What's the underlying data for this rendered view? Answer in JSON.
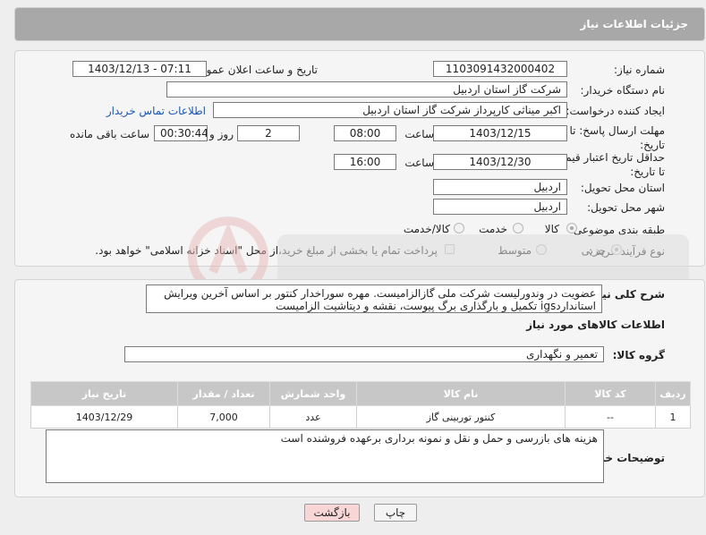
{
  "header": {
    "title": "جزئیات اطلاعات نیاز"
  },
  "fields": {
    "need_number_label": "شماره نیاز:",
    "need_number": "1103091432000402",
    "announce_label": "تاریخ و ساعت اعلان عمومی:",
    "announce_value": "1403/12/13 - 07:11",
    "buyer_org_label": "نام دستگاه خریدار:",
    "buyer_org": "شرکت گاز استان اردبیل",
    "creator_label": "ایجاد کننده درخواست:",
    "creator": "اکبر میناثی کارپرداز شرکت گاز استان اردبیل",
    "contact_link": "اطلاعات تماس خریدار",
    "deadline_label": "مهلت ارسال پاسخ: تا تاریخ:",
    "deadline_date": "1403/12/15",
    "time_label": "ساعت",
    "deadline_time": "08:00",
    "days_value": "2",
    "days_label": "روز و",
    "remaining_time": "00:30:44",
    "remaining_label": "ساعت باقی مانده",
    "min_validity_label": "حداقل تاریخ اعتبار قیمت: تا تاریخ:",
    "validity_date": "1403/12/30",
    "validity_time": "16:00",
    "province_label": "استان محل تحویل:",
    "province": "اردبیل",
    "city_label": "شهر محل تحویل:",
    "city": "اردبیل",
    "category_label": "طبقه بندی موضوعی:",
    "cat_goods": "کالا",
    "cat_service": "خدمت",
    "cat_goods_service": "کالا/خدمت",
    "process_label": "نوع فرآیند خرید :",
    "proc_minor": "جزیی",
    "proc_medium": "متوسط",
    "payment_note": "پرداخت تمام یا بخشی از مبلغ خرید،از محل \"اسناد خزانه اسلامی\" خواهد بود."
  },
  "description": {
    "label": "شرح کلی نیاز:",
    "text": "عضویت در وندورلیست شرکت ملی گازالزامیست. مهره سوراخدار کنتور بر اساس آخرین ویرایش استانداردigs تکمیل و بارگذاری برگ پیوست، نقشه و دیتاشیت الزامیست"
  },
  "goods": {
    "section_title": "اطلاعات کالاهای مورد نیاز",
    "group_label": "گروه کالا:",
    "group_value": "تعمیر و نگهداری",
    "columns": [
      "ردیف",
      "کد کالا",
      "نام کالا",
      "واحد شمارش",
      "تعداد / مقدار",
      "تاریخ نیاز"
    ],
    "rows": [
      {
        "row": "1",
        "code": "--",
        "name": "کنتور توربینی گاز",
        "unit": "عدد",
        "qty": "7,000",
        "date": "1403/12/29"
      }
    ]
  },
  "buyer_notes": {
    "label": "توضیحات خریدار:",
    "text": "هزینه های بازرسی و حمل و نقل و نمونه برداری برعهده فروشنده است"
  },
  "buttons": {
    "print": "چاپ",
    "back": "بازگشت"
  },
  "colors": {
    "header_bg": "#a8a8a8",
    "link": "#1a55b8",
    "back_btn_bg": "#f9d6d6"
  }
}
